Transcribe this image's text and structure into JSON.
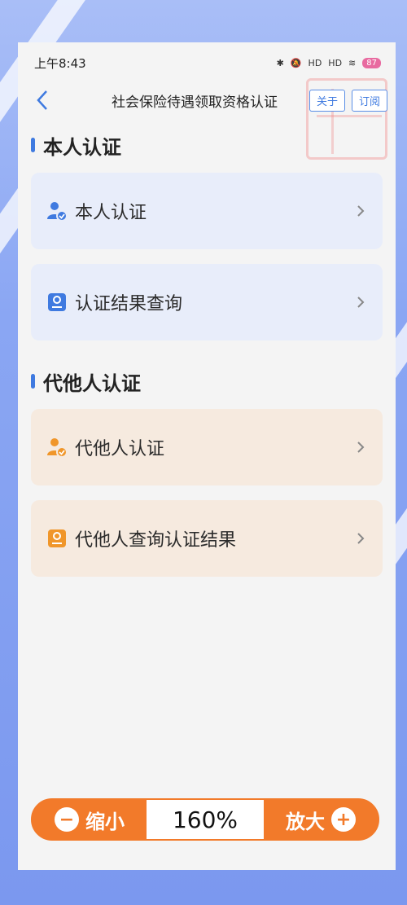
{
  "status": {
    "time": "上午8:43",
    "signal1": "HD",
    "signal2": "HD",
    "battery": "87"
  },
  "nav": {
    "title": "社会保险待遇领取资格认证",
    "about": "关于",
    "subscribe": "订阅"
  },
  "self_section": {
    "title": "本人认证",
    "items": [
      {
        "label": "本人认证",
        "icon": "person-check-icon"
      },
      {
        "label": "认证结果查询",
        "icon": "document-icon"
      }
    ]
  },
  "proxy_section": {
    "title": "代他人认证",
    "items": [
      {
        "label": "代他人认证",
        "icon": "person-check-icon"
      },
      {
        "label": "代他人查询认证结果",
        "icon": "document-icon"
      }
    ]
  },
  "zoom": {
    "out_label": "缩小",
    "value": "160%",
    "in_label": "放大",
    "minus": "−",
    "plus": "+"
  },
  "colors": {
    "accent_blue": "#3f7ae0",
    "accent_orange": "#f27a2a",
    "card_blue": "#e8edfa",
    "card_orange": "#f6eadf"
  }
}
